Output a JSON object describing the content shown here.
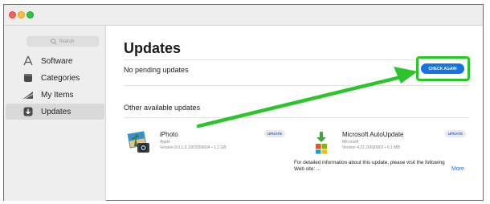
{
  "sidebar": {
    "search_placeholder": "Search",
    "items": [
      {
        "label": "Software",
        "icon": "software-icon"
      },
      {
        "label": "Categories",
        "icon": "categories-icon"
      },
      {
        "label": "My Items",
        "icon": "my-items-icon"
      },
      {
        "label": "Updates",
        "icon": "updates-icon",
        "selected": true
      }
    ]
  },
  "main": {
    "title": "Updates",
    "pending_status": "No pending updates",
    "check_again_label": "CHECK AGAIN",
    "other_section_title": "Other available updates",
    "apps": [
      {
        "name": "iPhoto",
        "developer": "Apple",
        "version": "Version 9.0.1.0.1263309604 • 1.1 GB",
        "button": "UPDATE",
        "icon": "iphoto-icon"
      },
      {
        "name": "Microsoft AutoUpdate",
        "developer": "Microsoft",
        "version": "Version 4.21.20030802 • 6.1 MB",
        "button": "UPDATE",
        "icon": "microsoft-autoupdate-icon",
        "info": "For detailed information about this update, please visit the following Web site: ...",
        "more": "More"
      }
    ]
  },
  "colors": {
    "accent": "#1573e6",
    "annotation": "#2cc42b"
  }
}
